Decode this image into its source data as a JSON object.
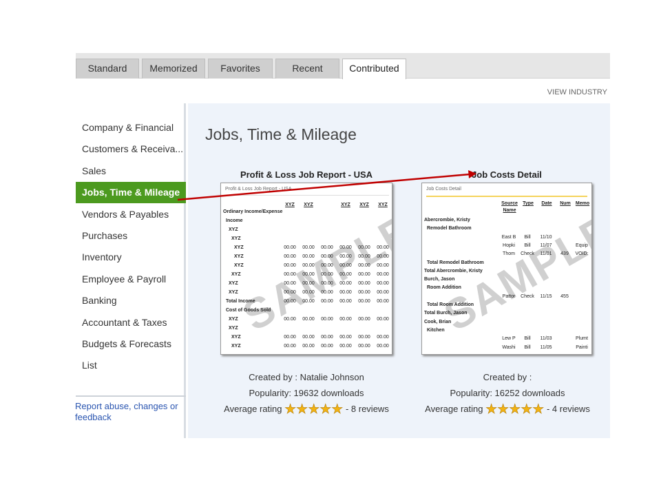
{
  "tabs": [
    {
      "label": "Standard"
    },
    {
      "label": "Memorized"
    },
    {
      "label": "Favorites"
    },
    {
      "label": "Recent"
    },
    {
      "label": "Contributed",
      "active": true
    }
  ],
  "view_industry": "VIEW INDUSTRY",
  "sidebar": {
    "items": [
      {
        "label": "Company & Financial"
      },
      {
        "label": "Customers & Receiva..."
      },
      {
        "label": "Sales"
      },
      {
        "label": "Jobs, Time & Mileage",
        "active": true
      },
      {
        "label": "Vendors & Payables"
      },
      {
        "label": "Purchases"
      },
      {
        "label": "Inventory"
      },
      {
        "label": "Employee & Payroll"
      },
      {
        "label": "Banking"
      },
      {
        "label": "Accountant & Taxes"
      },
      {
        "label": "Budgets & Forecasts"
      },
      {
        "label": "List"
      }
    ],
    "report_link": "Report abuse, changes or feedback"
  },
  "main": {
    "title": "Jobs, Time & Mileage",
    "reports": [
      {
        "title": "Profit & Loss Job Report - USA",
        "thumb_header": "Profit & Loss Job Report - USA",
        "watermark": "SAMPLE",
        "columns": [
          "XYZ",
          "XYZ",
          "",
          "XYZ",
          "XYZ",
          "XYZ"
        ],
        "rows": [
          {
            "label": "Ordinary Income/Expense",
            "indent": 0
          },
          {
            "label": "Income",
            "indent": 1
          },
          {
            "label": "XYZ",
            "indent": 2
          },
          {
            "label": "XYZ",
            "indent": 3
          },
          {
            "label": "XYZ",
            "indent": 4,
            "values": [
              "00.00",
              "00.00",
              "00.00",
              "00.00",
              "00.00",
              "00.00"
            ]
          },
          {
            "label": "XYZ",
            "indent": 4,
            "values": [
              "00.00",
              "00.00",
              "00.00",
              "00.00",
              "00.00",
              "00.00"
            ]
          },
          {
            "label": "XYZ",
            "indent": 4,
            "values": [
              "00.00",
              "00.00",
              "00.00",
              "00.00",
              "00.00",
              "00.00"
            ]
          },
          {
            "label": "XYZ",
            "indent": 3,
            "values": [
              "00.00",
              "00.00",
              "00.00",
              "00.00",
              "00.00",
              "00.00"
            ]
          },
          {
            "label": "XYZ",
            "indent": 2,
            "values": [
              "00.00",
              "00.00",
              "00.00",
              "00.00",
              "00.00",
              "00.00"
            ]
          },
          {
            "label": "XYZ",
            "indent": 2,
            "values": [
              "00.00",
              "00.00",
              "00.00",
              "00.00",
              "00.00",
              "00.00"
            ]
          },
          {
            "label": "Total Income",
            "indent": 1,
            "values": [
              "00.00",
              "00.00",
              "00.00",
              "00.00",
              "00.00",
              "00.00"
            ]
          },
          {
            "label": "Cost of Goods Sold",
            "indent": 1
          },
          {
            "label": "XYZ",
            "indent": 2,
            "values": [
              "00.00",
              "00.00",
              "00.00",
              "00.00",
              "00.00",
              "00.00"
            ]
          },
          {
            "label": "XYZ",
            "indent": 2
          },
          {
            "label": "XYZ",
            "indent": 3,
            "values": [
              "00.00",
              "00.00",
              "00.00",
              "00.00",
              "00.00",
              "00.00"
            ]
          },
          {
            "label": "XYZ",
            "indent": 3,
            "values": [
              "00.00",
              "00.00",
              "00.00",
              "00.00",
              "00.00",
              "00.00"
            ]
          }
        ],
        "created_by": "Created by : Natalie Johnson",
        "popularity": "Popularity:  19632  downloads",
        "rating_label": "Average rating",
        "rating": 5,
        "reviews": "- 8 reviews"
      },
      {
        "title": "Job Costs Detail",
        "thumb_header": "Job Costs Detail",
        "watermark": "SAMPLE",
        "columns": [
          "Source Name",
          "Type",
          "Date",
          "Num",
          "Memo"
        ],
        "rows": [
          {
            "label": "Abercrombie, Kristy",
            "indent": 0
          },
          {
            "label": "Remodel Bathroom",
            "indent": 1
          },
          {
            "label": "",
            "values": [
              "East B",
              "Bill",
              "11/10",
              "",
              ""
            ]
          },
          {
            "label": "",
            "values": [
              "Hopki",
              "Bill",
              "11/07",
              "",
              "Equip"
            ]
          },
          {
            "label": "",
            "values": [
              "Thom",
              "Check",
              "11/01",
              "439",
              "VOID:"
            ]
          },
          {
            "label": "Total Remodel Bathroom",
            "indent": 1
          },
          {
            "label": "Total Abercrombie, Kristy",
            "indent": 0
          },
          {
            "label": "Burch, Jason",
            "indent": 0
          },
          {
            "label": "Room Addition",
            "indent": 1
          },
          {
            "label": "",
            "values": [
              "Pattor",
              "Check",
              "11/15",
              "455",
              ""
            ]
          },
          {
            "label": "Total Room Addition",
            "indent": 1
          },
          {
            "label": "Total Burch, Jason",
            "indent": 0
          },
          {
            "label": "Cook, Brian",
            "indent": 0
          },
          {
            "label": "Kitchen",
            "indent": 1
          },
          {
            "label": "",
            "values": [
              "Lew P",
              "Bill",
              "11/03",
              "",
              "Plumt"
            ]
          },
          {
            "label": "",
            "values": [
              "Washi",
              "Bill",
              "11/05",
              "",
              "Painti"
            ]
          }
        ],
        "created_by": "Created by :",
        "popularity": "Popularity:  16252  downloads",
        "rating_label": "Average rating",
        "rating": 5,
        "reviews": "- 4 reviews"
      }
    ]
  },
  "colors": {
    "active_sidebar": "#4c9a1f",
    "arrow": "#c00000",
    "star": "#f2b313",
    "link": "#2a55b0"
  }
}
